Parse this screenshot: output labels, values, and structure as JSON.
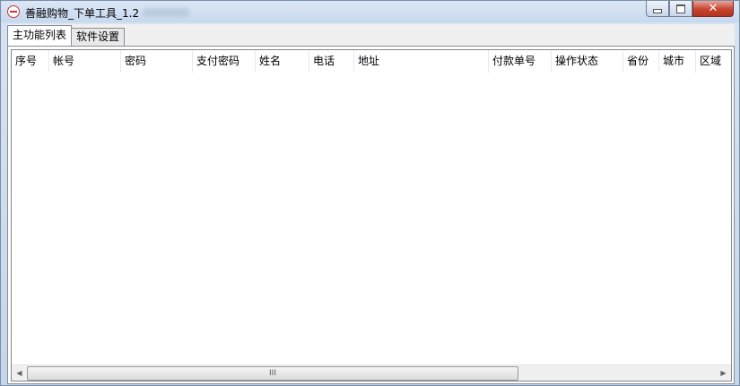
{
  "window": {
    "title": "善融购物_下单工具_1.2"
  },
  "tabs": [
    {
      "label": "主功能列表",
      "active": true
    },
    {
      "label": "软件设置",
      "active": false
    }
  ],
  "table": {
    "columns": [
      "序号",
      "帐号",
      "密码",
      "支付密码",
      "姓名",
      "电话",
      "地址",
      "付款单号",
      "操作状态",
      "省份",
      "城市",
      "区域"
    ],
    "rows": []
  },
  "scrollbar": {
    "grip": "III",
    "left_arrow": "◀",
    "right_arrow": "▶",
    "position": 0.0,
    "visible_fraction": 0.69
  },
  "icons": {
    "app": "no-entry-icon",
    "minimize": "minimize-icon",
    "maximize": "maximize-icon",
    "close": "close-icon"
  }
}
